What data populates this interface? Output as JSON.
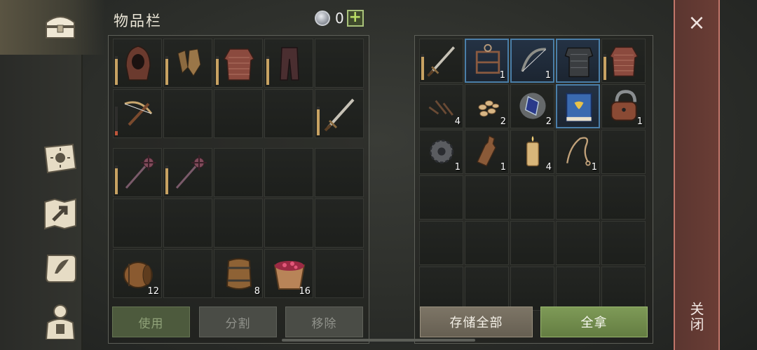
{
  "header": {
    "title": "物品栏",
    "currency_count": "0",
    "plus_label": "+"
  },
  "nav": {
    "items": [
      "chest-icon",
      "sun-book-icon",
      "map-icon",
      "scroll-icon",
      "character-icon"
    ]
  },
  "inventory": {
    "equipment": [
      {
        "icon": "hood-icon",
        "durability": 0.9
      },
      {
        "icon": "gloves-icon",
        "durability": 0.9
      },
      {
        "icon": "chainmail-icon",
        "durability": 0.9
      },
      {
        "icon": "pants-icon",
        "durability": 0.9
      },
      {
        "icon": "",
        "durability": null
      },
      {
        "icon": "crossbow-icon",
        "durability": 0.15
      },
      {
        "icon": "",
        "durability": null
      },
      {
        "icon": "",
        "durability": null
      },
      {
        "icon": "",
        "durability": null
      },
      {
        "icon": "sword-icon",
        "durability": 0.9
      }
    ],
    "bag": [
      {
        "icon": "mace-icon",
        "durability": 0.9,
        "qty": ""
      },
      {
        "icon": "mace-icon",
        "durability": 0.9,
        "qty": ""
      },
      {
        "icon": "",
        "qty": ""
      },
      {
        "icon": "",
        "qty": ""
      },
      {
        "icon": "",
        "qty": ""
      },
      {
        "icon": "",
        "qty": ""
      },
      {
        "icon": "",
        "qty": ""
      },
      {
        "icon": "",
        "qty": ""
      },
      {
        "icon": "",
        "qty": ""
      },
      {
        "icon": "",
        "qty": ""
      },
      {
        "icon": "barrel-icon",
        "qty": "12"
      },
      {
        "icon": "",
        "qty": ""
      },
      {
        "icon": "keg-icon",
        "qty": "8"
      },
      {
        "icon": "berry-bucket-icon",
        "qty": "16"
      },
      {
        "icon": "",
        "qty": ""
      }
    ],
    "buttons": {
      "use": "使用",
      "split": "分割",
      "remove": "移除"
    }
  },
  "storage": {
    "items": [
      {
        "icon": "sword-icon",
        "durability": 0.9,
        "qty": "",
        "hl": false
      },
      {
        "icon": "rack-icon",
        "qty": "1",
        "hl": true
      },
      {
        "icon": "bow-icon",
        "qty": "1",
        "hl": true
      },
      {
        "icon": "armor-icon",
        "qty": "",
        "hl": true
      },
      {
        "icon": "chainmail-icon",
        "durability": 0.9,
        "qty": "",
        "hl": false
      },
      {
        "icon": "nails-icon",
        "qty": "4",
        "hl": false
      },
      {
        "icon": "seeds-icon",
        "qty": "2",
        "hl": false
      },
      {
        "icon": "crystal-icon",
        "qty": "2",
        "hl": false
      },
      {
        "icon": "book-icon",
        "qty": "",
        "hl": true
      },
      {
        "icon": "padlock-icon",
        "qty": "1",
        "hl": false
      },
      {
        "icon": "gear-icon",
        "qty": "1",
        "hl": false
      },
      {
        "icon": "bottle-icon",
        "qty": "1",
        "hl": false
      },
      {
        "icon": "candle-icon",
        "qty": "4",
        "hl": false
      },
      {
        "icon": "rope-icon",
        "qty": "1",
        "hl": false
      },
      {
        "icon": "",
        "qty": ""
      }
    ],
    "buttons": {
      "store_all": "存储全部",
      "take_all": "全拿"
    }
  },
  "close": {
    "x": "×",
    "label": "关闭"
  }
}
